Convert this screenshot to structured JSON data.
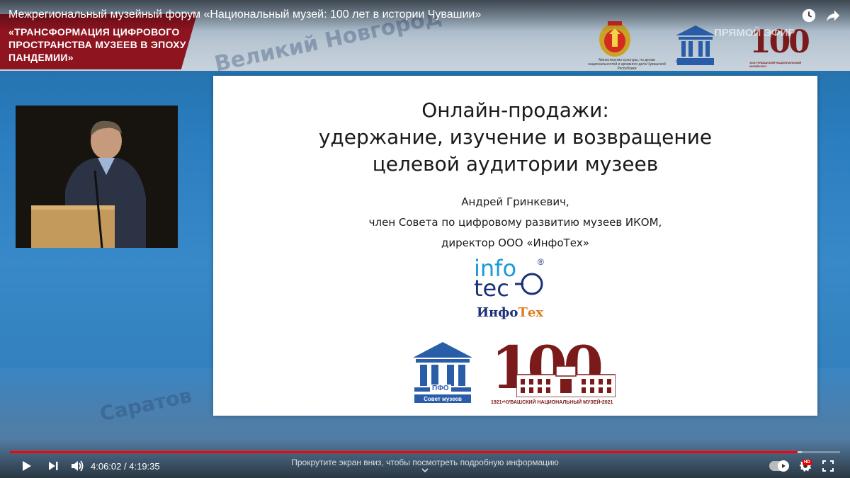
{
  "video": {
    "title": "Межрегиональный музейный форум «Национальный музей: 100 лет в истории Чувашии»"
  },
  "banner": {
    "line1": "«ТРАНСФОРМАЦИЯ ЦИФРОВОГО",
    "line2": "ПРОСТРАНСТВА МУЗЕЕВ В ЭПОХУ",
    "line3": "ПАНДЕМИИ»"
  },
  "background": {
    "map_label_top": "Великий Новгород",
    "map_label_bottom": "Саратов",
    "watermark": "ПРЯМОЙ ЭФИР"
  },
  "logos": {
    "ministry_caption": "Министерство культуры, по делам национальностей и архивного дела Чувашской Республики",
    "sovet_caption": "Совет музеев",
    "pfo_label": "ПФО",
    "museum100_caption": "1921•ЧУВАШСКИЙ НАЦИОНАЛЬНЫЙ МУЗЕЙ•2021"
  },
  "slide": {
    "title_line1": "Онлайн-продажи:",
    "title_line2": "удержание, изучение и возвращение",
    "title_line3": "целевой аудитории музеев",
    "author_name": "Андрей Гринкевич,",
    "author_role1": "член Совета по цифровому развитию музеев ИКОМ,",
    "author_role2": "директор ООО «ИнфоТех»",
    "infotech_logo_top": "info",
    "infotech_logo_bottom": "tec",
    "infotech_name_part1": "Инфо",
    "infotech_name_part2": "Тех",
    "registered_mark": "®",
    "number_100": "100"
  },
  "player": {
    "current_time": "4:06:02",
    "separator": "/",
    "duration": "4:19:35",
    "progress_fraction": 0.949,
    "scroll_hint": "Прокрутите экран вниз, чтобы посмотреть подробную информацию",
    "hd_badge": "HD"
  },
  "colors": {
    "banner_red": "#8e1420",
    "progress_red": "#ff0000",
    "infotech_blue": "#1b2f7a",
    "infotech_orange": "#e07a1f",
    "museum_maroon": "#7a1a1a",
    "sovet_blue": "#2a5da8"
  },
  "icons": {
    "play": "play-icon",
    "next": "next-icon",
    "volume": "volume-icon",
    "settings": "gear-icon",
    "fullscreen": "fullscreen-icon",
    "watch_later": "clock-icon",
    "share": "share-icon"
  }
}
